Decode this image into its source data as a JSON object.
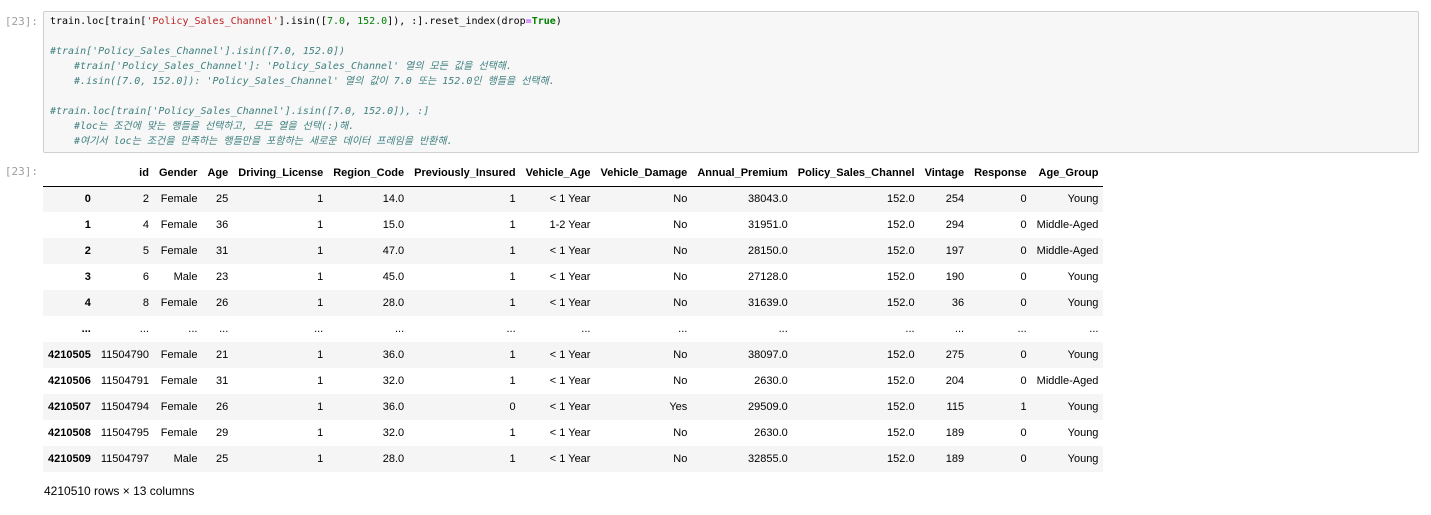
{
  "cell": {
    "in_prompt": "[23]:",
    "out_prompt": "[23]:",
    "code": [
      {
        "parts": [
          {
            "t": "train.loc[train[",
            "c": ""
          },
          {
            "t": "'Policy_Sales_Channel'",
            "c": "str"
          },
          {
            "t": "].isin([",
            "c": ""
          },
          {
            "t": "7.0",
            "c": "num"
          },
          {
            "t": ", ",
            "c": ""
          },
          {
            "t": "152.0",
            "c": "num"
          },
          {
            "t": "]), :].reset_index(drop",
            "c": ""
          },
          {
            "t": "=",
            "c": "op"
          },
          {
            "t": "True",
            "c": "kw"
          },
          {
            "t": ")",
            "c": ""
          }
        ]
      },
      {
        "parts": []
      },
      {
        "parts": [
          {
            "t": "#train['Policy_Sales_Channel'].isin([7.0, 152.0])",
            "c": "cm"
          }
        ]
      },
      {
        "indent": true,
        "parts": [
          {
            "t": "#train['Policy_Sales_Channel']: 'Policy_Sales_Channel' 열의 모든 값을 선택해.",
            "c": "cm"
          }
        ]
      },
      {
        "indent": true,
        "parts": [
          {
            "t": "#.isin([7.0, 152.0]): 'Policy_Sales_Channel' 열의 값이 7.0 또는 152.0인 행들을 선택해.",
            "c": "cm"
          }
        ]
      },
      {
        "parts": []
      },
      {
        "parts": [
          {
            "t": "#train.loc[train['Policy_Sales_Channel'].isin([7.0, 152.0]), :]",
            "c": "cm"
          }
        ]
      },
      {
        "indent": true,
        "parts": [
          {
            "t": "#loc는 조건에 맞는 행들을 선택하고, 모든 열을 선택(:)해.",
            "c": "cm"
          }
        ]
      },
      {
        "indent": true,
        "parts": [
          {
            "t": "#여기서 loc는 조건을 만족하는 행들만을 포함하는 새로운 데이터 프레임을 반환해.",
            "c": "cm"
          }
        ]
      }
    ]
  },
  "dataframe": {
    "columns": [
      "",
      "id",
      "Gender",
      "Age",
      "Driving_License",
      "Region_Code",
      "Previously_Insured",
      "Vehicle_Age",
      "Vehicle_Damage",
      "Annual_Premium",
      "Policy_Sales_Channel",
      "Vintage",
      "Response",
      "Age_Group"
    ],
    "rows": [
      [
        "0",
        "2",
        "Female",
        "25",
        "1",
        "14.0",
        "1",
        "< 1 Year",
        "No",
        "38043.0",
        "152.0",
        "254",
        "0",
        "Young"
      ],
      [
        "1",
        "4",
        "Female",
        "36",
        "1",
        "15.0",
        "1",
        "1-2 Year",
        "No",
        "31951.0",
        "152.0",
        "294",
        "0",
        "Middle-Aged"
      ],
      [
        "2",
        "5",
        "Female",
        "31",
        "1",
        "47.0",
        "1",
        "< 1 Year",
        "No",
        "28150.0",
        "152.0",
        "197",
        "0",
        "Middle-Aged"
      ],
      [
        "3",
        "6",
        "Male",
        "23",
        "1",
        "45.0",
        "1",
        "< 1 Year",
        "No",
        "27128.0",
        "152.0",
        "190",
        "0",
        "Young"
      ],
      [
        "4",
        "8",
        "Female",
        "26",
        "1",
        "28.0",
        "1",
        "< 1 Year",
        "No",
        "31639.0",
        "152.0",
        "36",
        "0",
        "Young"
      ],
      [
        "...",
        "...",
        "...",
        "...",
        "...",
        "...",
        "...",
        "...",
        "...",
        "...",
        "...",
        "...",
        "...",
        "..."
      ],
      [
        "4210505",
        "11504790",
        "Female",
        "21",
        "1",
        "36.0",
        "1",
        "< 1 Year",
        "No",
        "38097.0",
        "152.0",
        "275",
        "0",
        "Young"
      ],
      [
        "4210506",
        "11504791",
        "Female",
        "31",
        "1",
        "32.0",
        "1",
        "< 1 Year",
        "No",
        "2630.0",
        "152.0",
        "204",
        "0",
        "Middle-Aged"
      ],
      [
        "4210507",
        "11504794",
        "Female",
        "26",
        "1",
        "36.0",
        "0",
        "< 1 Year",
        "Yes",
        "29509.0",
        "152.0",
        "115",
        "1",
        "Young"
      ],
      [
        "4210508",
        "11504795",
        "Female",
        "29",
        "1",
        "32.0",
        "1",
        "< 1 Year",
        "No",
        "2630.0",
        "152.0",
        "189",
        "0",
        "Young"
      ],
      [
        "4210509",
        "11504797",
        "Male",
        "25",
        "1",
        "28.0",
        "1",
        "< 1 Year",
        "No",
        "32855.0",
        "152.0",
        "189",
        "0",
        "Young"
      ]
    ],
    "shape_text": "4210510 rows × 13 columns"
  }
}
